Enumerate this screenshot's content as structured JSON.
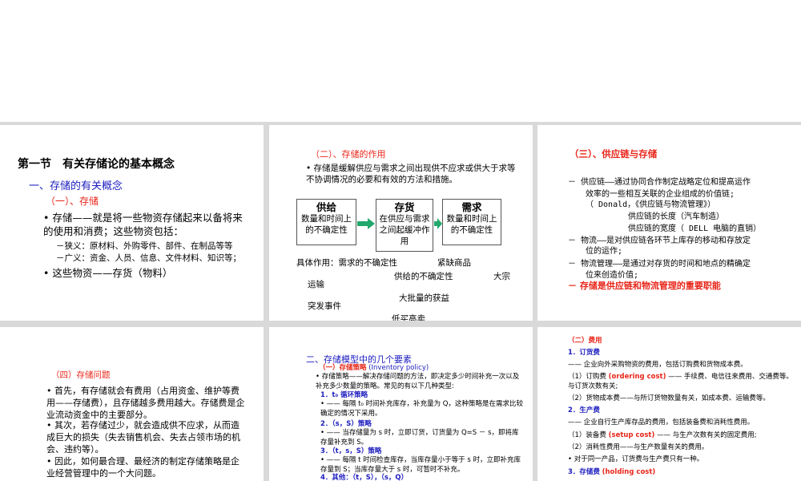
{
  "slide1": {
    "title": "第一节　有关存储论的基本概念",
    "sub1": "一、存储的有关概念",
    "sub2": "（一）、存储",
    "b1": "• 存储——就是将一些物资存储起来以备将来的使用和消费；这些物资包括：",
    "n1": "－狭义：原材料、外购零件、部件、在制品等等",
    "n2": "－广义：资金、人员、信息、文件材料、知识等；",
    "b2": "• 这些物资——存货（物料）"
  },
  "slide2": {
    "title": "（二）、存储的作用",
    "b1": "• 存储是缓解供应与需求之间出现供不应求或供大于求等不协调情况的必要和有效的方法和措施。",
    "box1_head": "供给",
    "box1_body": "数量和时间上的不确定性",
    "box2_head": "存货",
    "box2_body": "在供应与需求之间起缓冲作用",
    "box3_head": "需求",
    "box3_body": "数量和时间上的不确定性",
    "t1": "具体作用：需求的不确定性",
    "t2": "紧缺商品",
    "t3": "供给的不确定性",
    "t4": "大宗",
    "t5": "运输",
    "t6": "大批量的获益",
    "t7": "突发事件",
    "t8": "低买高卖"
  },
  "slide3": {
    "title": "（三）、供应链与存储",
    "l1": "－  供应链——通过协同合作制定战略定位和提高运作",
    "l2": "效率的一些相互关联的企业组成的价值链;",
    "l3": "（  Donald，《供应链与物流管理》）",
    "l4": "供应链的长度（汽车制造）",
    "l5": "供应链的宽度（ DELL 电脑的直销）",
    "l6": "－  物流——是对供应链各环节上库存的移动和存放定",
    "l7": "位的运作;",
    "l8": "－  物流管理——是通过对存货的时间和地点的精确定",
    "l9": "位来创造价值;",
    "l10": "－  存储是供应链和物流管理的重要职能"
  },
  "slide4": {
    "title": "（四）存储问题",
    "p1": "• 首先，有存储就会有费用（占用资金、维护等费用——存储费），且存储越多费用越大。存储费是企业流动资金中的主要部分。",
    "p2": "• 其次，若存储过少，就会造成供不应求，从而造成巨大的损失（失去销售机会、失去占领市场的机会、违约等）。",
    "p3": "• 因此，如何最合理、最经济的制定存储策略是企业经营管理中的一个大问题。"
  },
  "slide5": {
    "title": "二、存储模型中的几个要素",
    "r1a": "（一）存储策略",
    "r1b": "(Inventory policy)",
    "r2": "• 存储策略——解决存储问题的方法，即决定多少时间补充一次以及补充多少数量的策略。常见的有以下几种类型:",
    "r3": "1．t₀ 循环策略",
    "r4": "• —— 每隔 t₀ 时间补充库存，补充量为 Q，这种策略是在需求比较确定的情况下采用。",
    "r5": "2．（s，S）策略",
    "r6": "• —— 当存储量为 s 时，立即订货，订货量为 Q=S － s，即将库存量补充到 S。",
    "r7": "3．（t，s，S）策略",
    "r8": "• —— 每隔 t 时间检查库存，当库存量小于等于 s 时，立即补充库存量到 S；当库存量大于 s 时，可暂时不补充。",
    "r9": "4．其他：（t，S），（s，Q）"
  },
  "slide6": {
    "q1": "（二）费用",
    "q2": "1．订货费",
    "q3": "—— 企业向外采购物资的费用，包括订购费和货物成本费。",
    "q4a": "（1）订购费",
    "q4b": "(ordering cost)",
    "q4c": "—— 手续费、电信往来费用、交通费等。与订货次数有关;",
    "q5": "（2）货物成本费——与所订货物数量有关，如成本费、运输费等。",
    "q6": "2．生产费",
    "q7": "—— 企业自行生产库存品的费用，包括装备费和消耗性费用。",
    "q8a": "（1）装备费",
    "q8b": "(setup cost)",
    "q8c": "—— 与生产次数有关的固定费用;",
    "q9": "（2）消耗性费用——与生产数量有关的费用。",
    "q10": "• 对于同一产品，订货费与生产费只有一种。",
    "q11a": "3．存储费",
    "q11b": "(holding cost)"
  },
  "colors": {
    "accent_red": "#e8261a",
    "heading_blue": "#1d1dbf",
    "arrow_green": "#22a86a",
    "divider_gray": "#d9d9d9"
  }
}
